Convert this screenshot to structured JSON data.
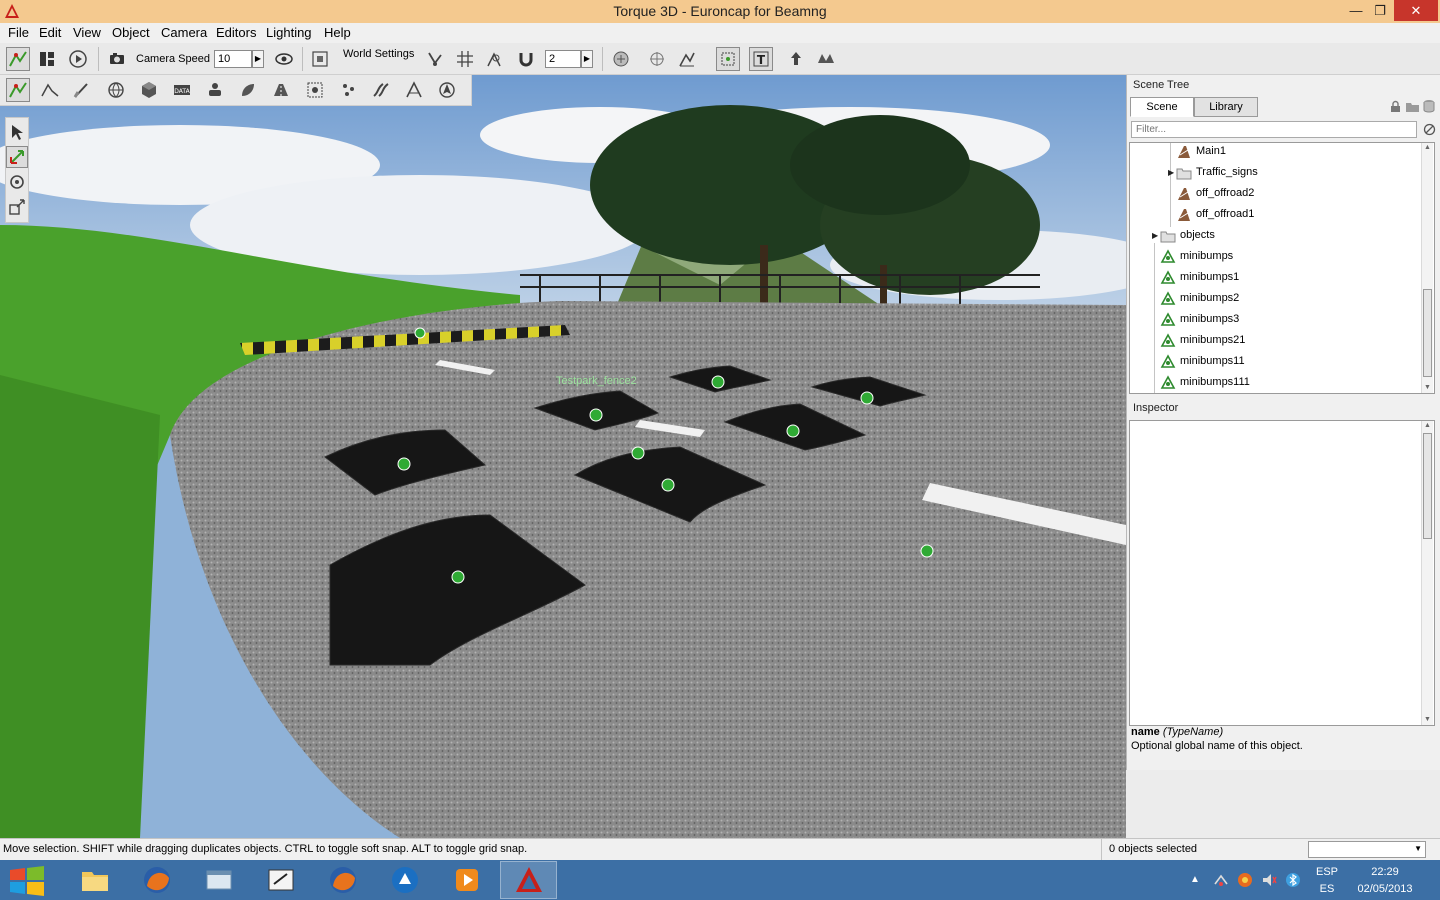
{
  "window": {
    "title": "Torque 3D - Euroncap for Beamng",
    "min_glyph": "—",
    "max_glyph": "❐",
    "close_glyph": "✕"
  },
  "menu": [
    "File",
    "Edit",
    "View",
    "Object",
    "Camera",
    "Editors",
    "Lighting",
    "Help"
  ],
  "toolbar": {
    "camera_speed_label": "Camera Speed",
    "camera_speed_value": "10",
    "world_settings_label": "World Settings",
    "grid_value": "2"
  },
  "viewport": {
    "object_label": "Testpark_fence2"
  },
  "scene_tree": {
    "title": "Scene Tree",
    "tabs": [
      "Scene",
      "Library"
    ],
    "filter_placeholder": "Filter...",
    "items": [
      {
        "label": "Main1",
        "icon": "road-icon",
        "indent": 1,
        "expandable": false
      },
      {
        "label": "Traffic_signs",
        "icon": "folder-icon",
        "indent": 1,
        "expandable": true
      },
      {
        "label": "off_offroad2",
        "icon": "road-icon",
        "indent": 1,
        "expandable": false
      },
      {
        "label": "off_offroad1",
        "icon": "road-icon",
        "indent": 1,
        "expandable": false
      },
      {
        "label": "objects",
        "icon": "folder-icon",
        "indent": 0,
        "expandable": true
      },
      {
        "label": "minibumps",
        "icon": "mesh-icon",
        "indent": 0,
        "expandable": false
      },
      {
        "label": "minibumps1",
        "icon": "mesh-icon",
        "indent": 0,
        "expandable": false
      },
      {
        "label": "minibumps2",
        "icon": "mesh-icon",
        "indent": 0,
        "expandable": false
      },
      {
        "label": "minibumps3",
        "icon": "mesh-icon",
        "indent": 0,
        "expandable": false
      },
      {
        "label": "minibumps21",
        "icon": "mesh-icon",
        "indent": 0,
        "expandable": false
      },
      {
        "label": "minibumps11",
        "icon": "mesh-icon",
        "indent": 0,
        "expandable": false
      },
      {
        "label": "minibumps111",
        "icon": "mesh-icon",
        "indent": 0,
        "expandable": false
      }
    ]
  },
  "inspector": {
    "title": "Inspector",
    "field_name": "name",
    "field_type": "(TypeName)",
    "description": "Optional global name of this object."
  },
  "status": {
    "hint": "Move selection.  SHIFT while dragging duplicates objects.  CTRL to toggle soft snap.  ALT to toggle grid snap.",
    "selection": "0 objects selected"
  },
  "taskbar": {
    "lang": "ESP",
    "lang_sub": "ES",
    "time": "22:29",
    "date": "02/05/2013"
  },
  "colors": {
    "title_bar": "#f4c98f",
    "close_button": "#c7352b",
    "taskbar": "#3c6fa5",
    "grass": "#4aa12c",
    "asphalt": "#8c8c8c"
  }
}
